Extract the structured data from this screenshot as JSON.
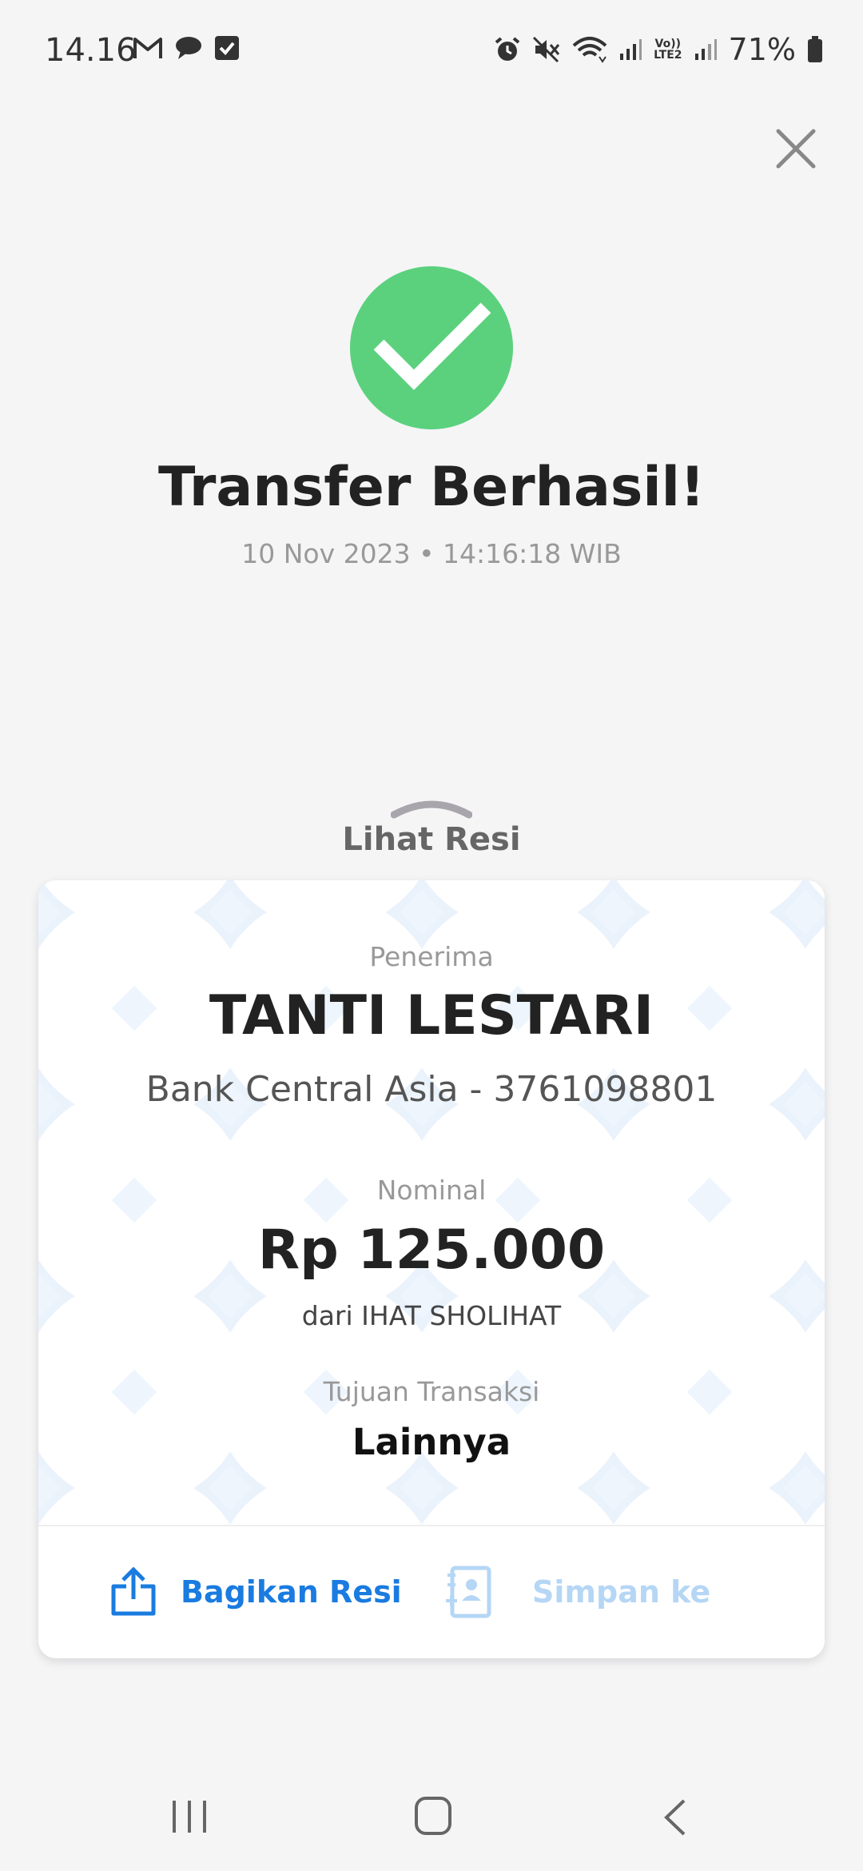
{
  "status_bar": {
    "time": "14.16",
    "battery_percent": "71%",
    "lte_line1": "Vo))",
    "lte_line2": "LTE2",
    "left_icons": [
      "gmail-icon",
      "chat-icon",
      "checkbox-icon"
    ],
    "right_icons": [
      "alarm-icon",
      "mute-icon",
      "wifi-icon",
      "signal-icon",
      "lte-icon",
      "signal-icon",
      "battery-icon"
    ]
  },
  "header": {
    "title": "Transfer Berhasil!",
    "datetime": "10 Nov 2023 • 14:16:18 WIB"
  },
  "receipt_toggle": {
    "label": "Lihat Resi"
  },
  "receipt": {
    "recipient_label": "Penerima",
    "recipient_name": "TANTI LESTARI",
    "recipient_bank": "Bank Central Asia - 3761098801",
    "amount_label": "Nominal",
    "amount": "Rp 125.000",
    "sender": "dari IHAT SHOLIHAT",
    "purpose_label": "Tujuan Transaksi",
    "purpose": "Lainnya"
  },
  "actions": {
    "share_label": "Bagikan Resi",
    "save_label": "Simpan ke"
  },
  "colors": {
    "success_green": "#5bd17e",
    "primary_blue": "#1a7be0",
    "disabled_blue": "#b5d6f5",
    "background": "#f5f5f6"
  }
}
